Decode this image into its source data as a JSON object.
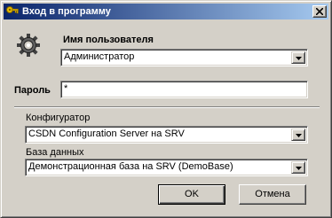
{
  "window": {
    "title": "Вход в программу"
  },
  "icons": {
    "title": "key-icon",
    "logo": "gear-icon",
    "close": "close-x-icon",
    "dropdown": "chevron-down-icon"
  },
  "username": {
    "label": "Имя пользователя",
    "value": "Администратор"
  },
  "password": {
    "label": "Пароль",
    "value": "*"
  },
  "configurator": {
    "label": "Конфигуратор",
    "value": "CSDN Configuration Server на SRV"
  },
  "database": {
    "label": "База данных",
    "value": "Демонстрационная база на SRV (DemoBase)"
  },
  "buttons": {
    "ok": "OK",
    "cancel": "Отмена"
  },
  "colors": {
    "title_gradient_start": "#0a246a",
    "title_gradient_end": "#a6caf0",
    "face": "#d4d0c8"
  }
}
